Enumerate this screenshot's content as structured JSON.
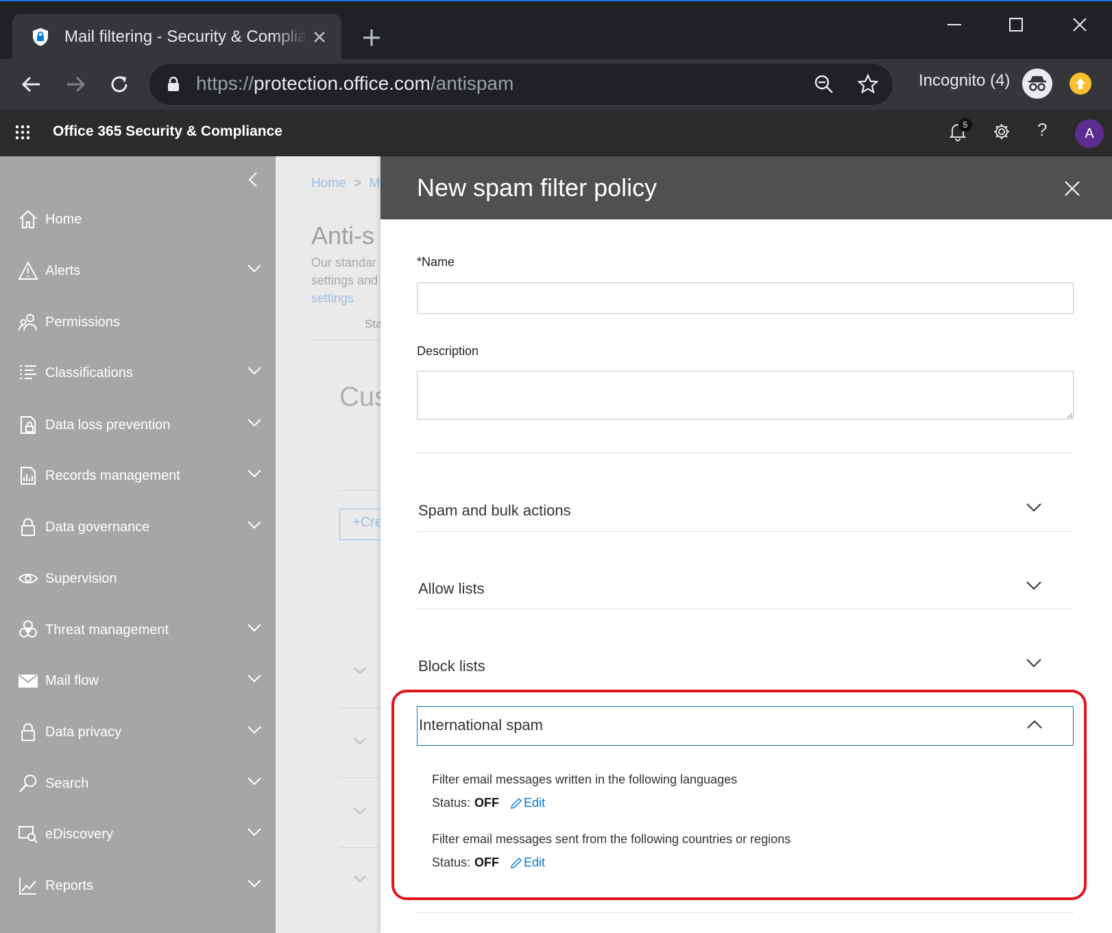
{
  "browser": {
    "tab_title": "Mail filtering - Security & Compliance",
    "url_scheme": "https://",
    "url_host": "protection.office.com",
    "url_path": "/antispam",
    "incognito_label": "Incognito (4)"
  },
  "app": {
    "title": "Office 365 Security & Compliance",
    "notification_count": "5",
    "help_glyph": "?",
    "avatar_initial": "A"
  },
  "nav": {
    "items": [
      {
        "label": "Home",
        "icon": "home-icon",
        "expandable": false
      },
      {
        "label": "Alerts",
        "icon": "alert-icon",
        "expandable": true
      },
      {
        "label": "Permissions",
        "icon": "people-icon",
        "expandable": false
      },
      {
        "label": "Classifications",
        "icon": "list-icon",
        "expandable": true
      },
      {
        "label": "Data loss prevention",
        "icon": "dlp-icon",
        "expandable": true
      },
      {
        "label": "Records management",
        "icon": "records-icon",
        "expandable": true
      },
      {
        "label": "Data governance",
        "icon": "lock-icon",
        "expandable": true
      },
      {
        "label": "Supervision",
        "icon": "eye-icon",
        "expandable": false
      },
      {
        "label": "Threat management",
        "icon": "biohazard-icon",
        "expandable": true
      },
      {
        "label": "Mail flow",
        "icon": "mail-icon",
        "expandable": true
      },
      {
        "label": "Data privacy",
        "icon": "lock-icon",
        "expandable": true
      },
      {
        "label": "Search",
        "icon": "search-icon",
        "expandable": true
      },
      {
        "label": "eDiscovery",
        "icon": "ediscovery-icon",
        "expandable": true
      },
      {
        "label": "Reports",
        "icon": "chart-icon",
        "expandable": true
      }
    ]
  },
  "background": {
    "crumb_home": "Home",
    "crumb_sep": ">",
    "crumb_next": "M",
    "title_fragment": "Anti-s",
    "desc_line1": "Our standar",
    "desc_line2": "settings and",
    "desc_link": "settings",
    "sta_fragment": "Sta",
    "custom_fragment": "Cus",
    "create_fragment": "Cre"
  },
  "panel": {
    "title": "New spam filter policy",
    "name_label": "*Name",
    "name_value": "",
    "description_label": "Description",
    "description_value": "",
    "sections": [
      {
        "label": "Spam and bulk actions",
        "expanded": false
      },
      {
        "label": "Allow lists",
        "expanded": false
      },
      {
        "label": "Block lists",
        "expanded": false
      },
      {
        "label": "International spam",
        "expanded": true
      }
    ],
    "international": {
      "languages_text": "Filter email messages written in the following languages",
      "languages_status_label": "Status:",
      "languages_status_value": "OFF",
      "countries_text": "Filter email messages sent from the following countries or regions",
      "countries_status_label": "Status:",
      "countries_status_value": "OFF",
      "edit_label": "Edit"
    }
  },
  "colors": {
    "accent": "#0078d4",
    "highlight": "#e0161b",
    "panel_header": "#505050",
    "nav_dimmed": "#a6a6a6"
  }
}
